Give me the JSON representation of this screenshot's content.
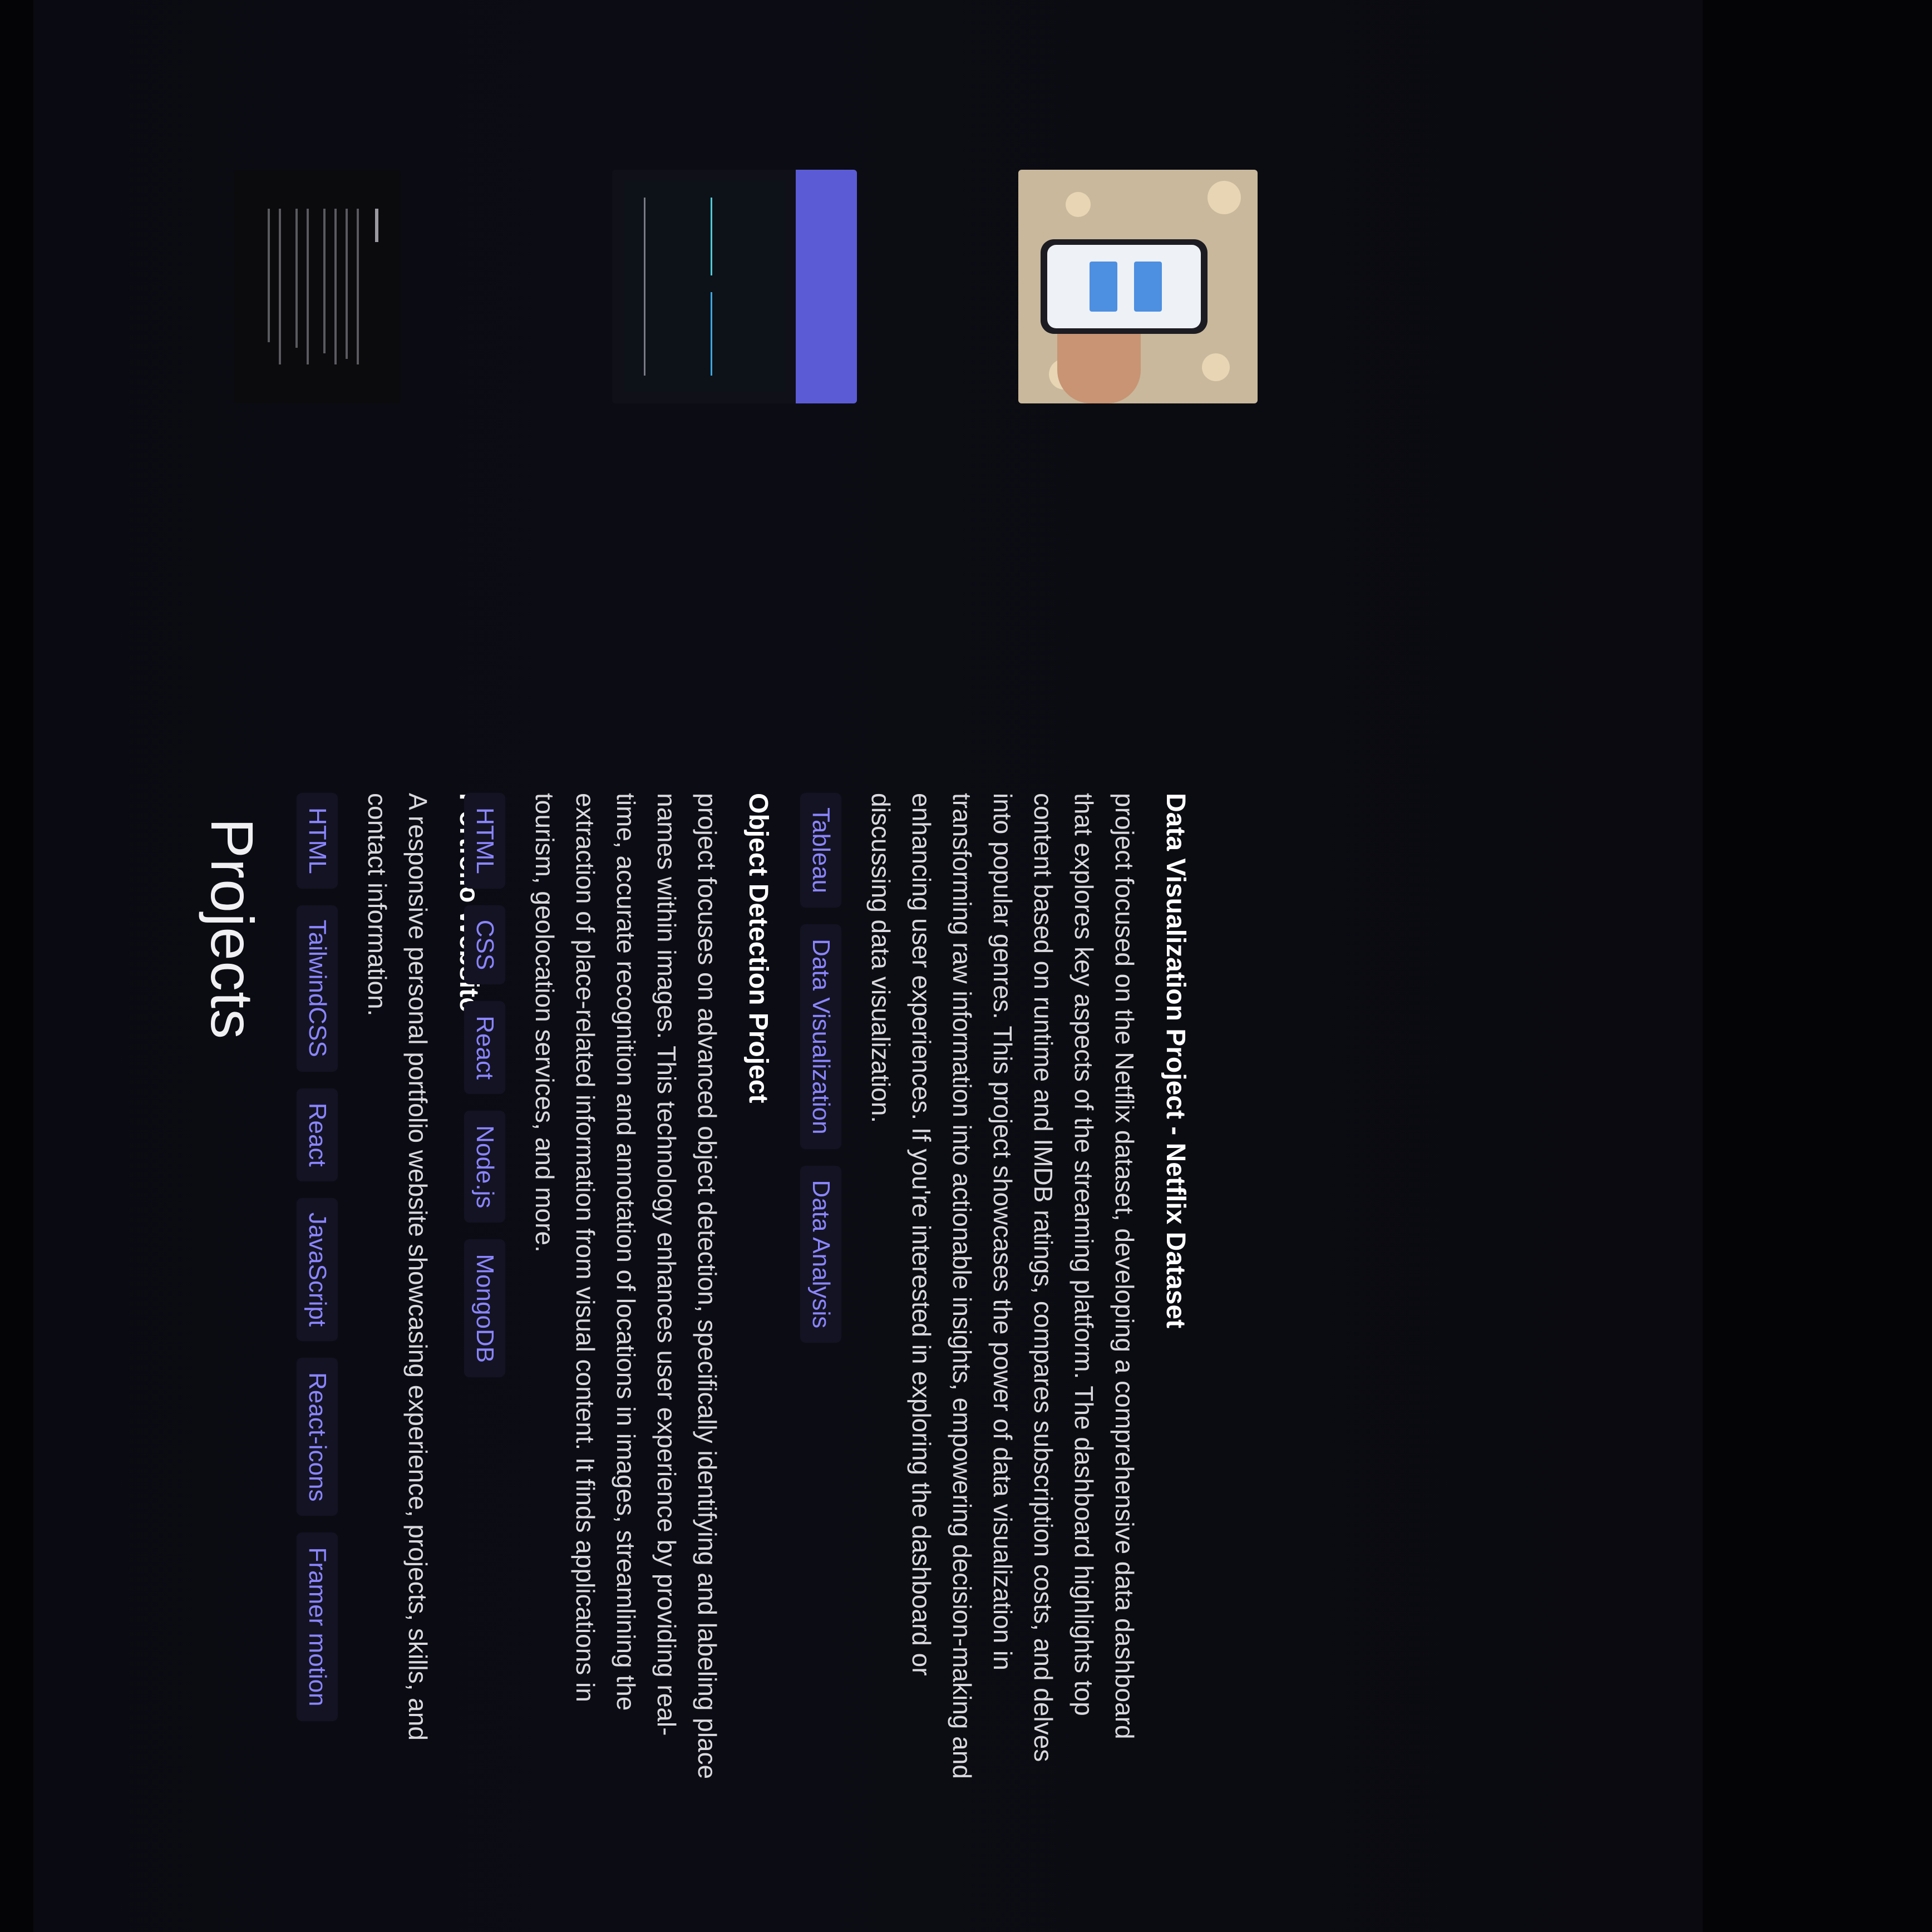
{
  "page": {
    "title": "Projects"
  },
  "projects": [
    {
      "title": "Portfolio Website",
      "description": "A responsive personal portfolio website showcasing experience, projects, skills, and contact information.",
      "tags": [
        "HTML",
        "TailwindCSS",
        "React",
        "JavaScript",
        "React-icons",
        "Framer motion"
      ]
    },
    {
      "title": "Object Detection Project",
      "description": "project focuses on advanced object detection, specifically identifying and labeling place names within images. This technology enhances user experience by providing real-time, accurate recognition and annotation of locations in images, streamlining the extraction of place-related information from visual content. It finds applications in tourism, geolocation services, and more.",
      "tags": [
        "HTML",
        "CSS",
        "React",
        "Node.js",
        "MongoDB"
      ]
    },
    {
      "title": "Data Visualization Project - Netflix Dataset",
      "description": "project focused on the Netflix dataset, developing a comprehensive data dashboard that explores key aspects of the streaming platform. The dashboard highlights top content based on runtime and IMDB ratings, compares subscription costs, and delves into popular genres. This project showcases the power of data visualization in transforming raw information into actionable insights, empowering decision-making and enhancing user experiences. If you're interested in exploring the dashboard or discussing data visualization.",
      "tags": [
        "Tableau",
        "Data Visualization",
        "Data Analysis"
      ]
    }
  ],
  "colors": {
    "background": "#0b0c12",
    "tag_text": "#8b86ff",
    "tag_background": "#141324",
    "heading": "#ffffff",
    "body_text": "#d9d9df"
  }
}
